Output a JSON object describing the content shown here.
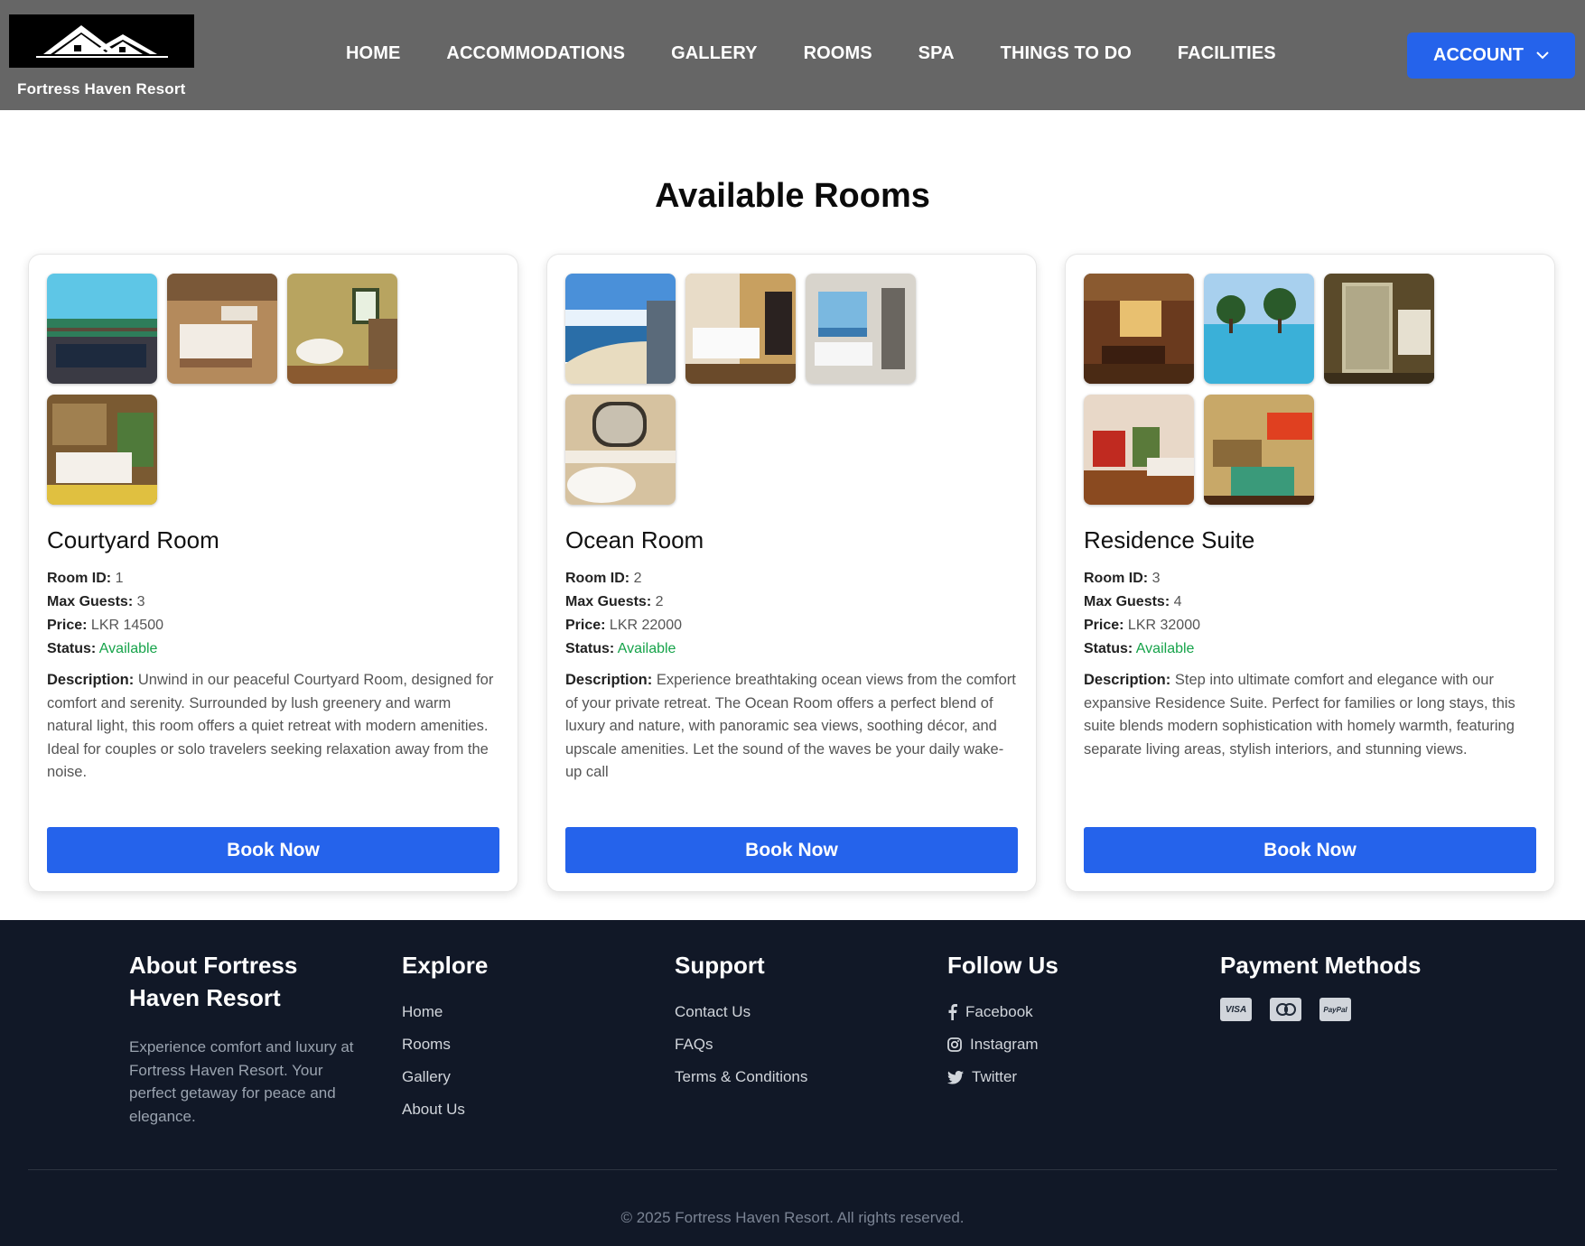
{
  "header": {
    "brand_name": "Fortress Haven Resort",
    "nav": [
      "HOME",
      "ACCOMMODATIONS",
      "GALLERY",
      "ROOMS",
      "SPA",
      "THINGS TO DO",
      "FACILITIES"
    ],
    "account_label": "ACCOUNT"
  },
  "main": {
    "title": "Available Rooms",
    "labels": {
      "room_id": "Room ID:",
      "max_guests": "Max Guests:",
      "price": "Price:",
      "status": "Status:",
      "description": "Description:"
    },
    "rooms": [
      {
        "name": "Courtyard Room",
        "room_id": "1",
        "max_guests": "3",
        "price": "LKR 14500",
        "status": "Available",
        "description": "Unwind in our peaceful Courtyard Room, designed for comfort and serenity. Surrounded by lush greenery and warm natural light, this room offers a quiet retreat with modern amenities. Ideal for couples or solo travelers seeking relaxation away from the noise.",
        "book_label": "Book Now"
      },
      {
        "name": "Ocean Room",
        "room_id": "2",
        "max_guests": "2",
        "price": "LKR 22000",
        "status": "Available",
        "description": "Experience breathtaking ocean views from the comfort of your private retreat. The Ocean Room offers a perfect blend of luxury and nature, with panoramic sea views, soothing décor, and upscale amenities. Let the sound of the waves be your daily wake-up call",
        "book_label": "Book Now"
      },
      {
        "name": "Residence Suite",
        "room_id": "3",
        "max_guests": "4",
        "price": "LKR 32000",
        "status": "Available",
        "description": "Step into ultimate comfort and elegance with our expansive Residence Suite. Perfect for families or long stays, this suite blends modern sophistication with homely warmth, featuring separate living areas, stylish interiors, and stunning views.",
        "book_label": "Book Now"
      }
    ]
  },
  "footer": {
    "about_title": "About Fortress Haven Resort",
    "about_text": "Experience comfort and luxury at Fortress Haven Resort. Your perfect getaway for peace and elegance.",
    "explore_title": "Explore",
    "explore_links": [
      "Home",
      "Rooms",
      "Gallery",
      "About Us"
    ],
    "support_title": "Support",
    "support_links": [
      "Contact Us",
      "FAQs",
      "Terms & Conditions"
    ],
    "follow_title": "Follow Us",
    "follow_links": [
      {
        "label": "Facebook",
        "icon": "facebook-icon"
      },
      {
        "label": "Instagram",
        "icon": "instagram-icon"
      },
      {
        "label": "Twitter",
        "icon": "twitter-icon"
      }
    ],
    "payment_title": "Payment Methods",
    "payment_methods": [
      "VISA",
      "mastercard",
      "PayPal"
    ],
    "copyright": "© 2025 Fortress Haven Resort. All rights reserved."
  },
  "colors": {
    "header_bg": "#666666",
    "accent": "#2563eb",
    "available": "#16a34a",
    "footer_bg": "#111827"
  }
}
